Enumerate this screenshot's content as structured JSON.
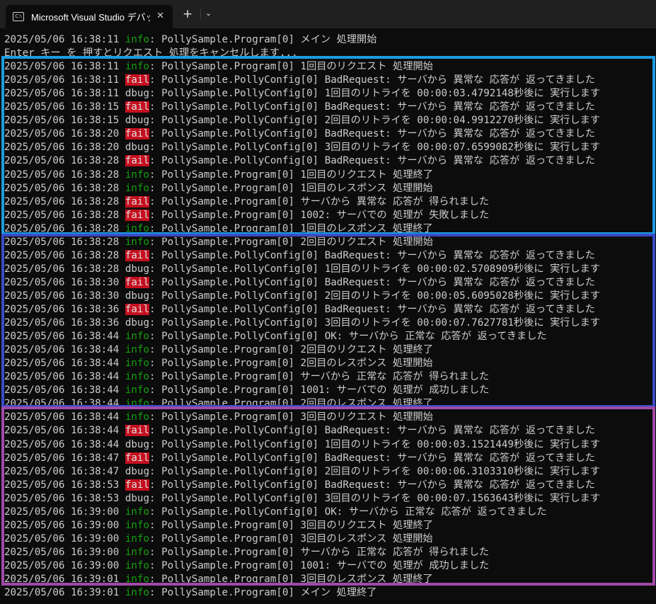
{
  "window": {
    "tab_title": "Microsoft Visual Studio デバッグ",
    "tab_icon": "C:\\",
    "close_glyph": "✕",
    "new_tab_glyph": "+",
    "dropdown_glyph": "⌄"
  },
  "box_colors": [
    "#1a9de0",
    "#3a4cc8",
    "#a04aa8"
  ],
  "lines": [
    {
      "ts": "2025/05/06 16:38:11",
      "level": "",
      "msg": "info: PollySample.Program[0] メイン 処理開始"
    },
    {
      "ts": "",
      "level": "",
      "msg": "Enter キー を 押すとリクエスト 処理をキャンセルします..."
    },
    {
      "ts": "2025/05/06 16:38:11",
      "level": "info",
      "msg": ": PollySample.Program[0] 1回目のリクエスト 処理開始"
    },
    {
      "ts": "2025/05/06 16:38:11",
      "level": "fail",
      "msg": ": PollySample.PollyConfig[0] BadRequest: サーバから 異常な 応答が 返ってきました"
    },
    {
      "ts": "2025/05/06 16:38:11",
      "level": "dbug",
      "msg": ": PollySample.PollyConfig[0] 1回目のリトライを 00:00:03.4792148秒後に 実行します"
    },
    {
      "ts": "2025/05/06 16:38:15",
      "level": "fail",
      "msg": ": PollySample.PollyConfig[0] BadRequest: サーバから 異常な 応答が 返ってきました"
    },
    {
      "ts": "2025/05/06 16:38:15",
      "level": "dbug",
      "msg": ": PollySample.PollyConfig[0] 2回目のリトライを 00:00:04.9912270秒後に 実行します"
    },
    {
      "ts": "2025/05/06 16:38:20",
      "level": "fail",
      "msg": ": PollySample.PollyConfig[0] BadRequest: サーバから 異常な 応答が 返ってきました"
    },
    {
      "ts": "2025/05/06 16:38:20",
      "level": "dbug",
      "msg": ": PollySample.PollyConfig[0] 3回目のリトライを 00:00:07.6599082秒後に 実行します"
    },
    {
      "ts": "2025/05/06 16:38:28",
      "level": "fail",
      "msg": ": PollySample.PollyConfig[0] BadRequest: サーバから 異常な 応答が 返ってきました"
    },
    {
      "ts": "2025/05/06 16:38:28",
      "level": "info",
      "msg": ": PollySample.Program[0] 1回目のリクエスト 処理終了"
    },
    {
      "ts": "2025/05/06 16:38:28",
      "level": "info",
      "msg": ": PollySample.Program[0] 1回目のレスポンス 処理開始"
    },
    {
      "ts": "2025/05/06 16:38:28",
      "level": "fail",
      "msg": ": PollySample.Program[0] サーバから 異常な 応答が 得られました"
    },
    {
      "ts": "2025/05/06 16:38:28",
      "level": "fail",
      "msg": ": PollySample.Program[0] 1002: サーバでの 処理が 失敗しました"
    },
    {
      "ts": "2025/05/06 16:38:28",
      "level": "info",
      "msg": ": PollySample.Program[0] 1回目のレスポンス 処理終了"
    },
    {
      "ts": "2025/05/06 16:38:28",
      "level": "info",
      "msg": ": PollySample.Program[0] 2回目のリクエスト 処理開始"
    },
    {
      "ts": "2025/05/06 16:38:28",
      "level": "fail",
      "msg": ": PollySample.PollyConfig[0] BadRequest: サーバから 異常な 応答が 返ってきました"
    },
    {
      "ts": "2025/05/06 16:38:28",
      "level": "dbug",
      "msg": ": PollySample.PollyConfig[0] 1回目のリトライを 00:00:02.5708909秒後に 実行します"
    },
    {
      "ts": "2025/05/06 16:38:30",
      "level": "fail",
      "msg": ": PollySample.PollyConfig[0] BadRequest: サーバから 異常な 応答が 返ってきました"
    },
    {
      "ts": "2025/05/06 16:38:30",
      "level": "dbug",
      "msg": ": PollySample.PollyConfig[0] 2回目のリトライを 00:00:05.6095028秒後に 実行します"
    },
    {
      "ts": "2025/05/06 16:38:36",
      "level": "fail",
      "msg": ": PollySample.PollyConfig[0] BadRequest: サーバから 異常な 応答が 返ってきました"
    },
    {
      "ts": "2025/05/06 16:38:36",
      "level": "dbug",
      "msg": ": PollySample.PollyConfig[0] 3回目のリトライを 00:00:07.7627781秒後に 実行します"
    },
    {
      "ts": "2025/05/06 16:38:44",
      "level": "info",
      "msg": ": PollySample.PollyConfig[0] OK: サーバから 正常な 応答が 返ってきました"
    },
    {
      "ts": "2025/05/06 16:38:44",
      "level": "info",
      "msg": ": PollySample.Program[0] 2回目のリクエスト 処理終了"
    },
    {
      "ts": "2025/05/06 16:38:44",
      "level": "info",
      "msg": ": PollySample.Program[0] 2回目のレスポンス 処理開始"
    },
    {
      "ts": "2025/05/06 16:38:44",
      "level": "info",
      "msg": ": PollySample.Program[0] サーバから 正常な 応答が 得られました"
    },
    {
      "ts": "2025/05/06 16:38:44",
      "level": "info",
      "msg": ": PollySample.Program[0] 1001: サーバでの 処理が 成功しました"
    },
    {
      "ts": "2025/05/06 16:38:44",
      "level": "info",
      "msg": ": PollySample.Program[0] 2回目のレスポンス 処理終了"
    },
    {
      "ts": "2025/05/06 16:38:44",
      "level": "info",
      "msg": ": PollySample.Program[0] 3回目のリクエスト 処理開始"
    },
    {
      "ts": "2025/05/06 16:38:44",
      "level": "fail",
      "msg": ": PollySample.PollyConfig[0] BadRequest: サーバから 異常な 応答が 返ってきました"
    },
    {
      "ts": "2025/05/06 16:38:44",
      "level": "dbug",
      "msg": ": PollySample.PollyConfig[0] 1回目のリトライを 00:00:03.1521449秒後に 実行します"
    },
    {
      "ts": "2025/05/06 16:38:47",
      "level": "fail",
      "msg": ": PollySample.PollyConfig[0] BadRequest: サーバから 異常な 応答が 返ってきました"
    },
    {
      "ts": "2025/05/06 16:38:47",
      "level": "dbug",
      "msg": ": PollySample.PollyConfig[0] 2回目のリトライを 00:00:06.3103310秒後に 実行します"
    },
    {
      "ts": "2025/05/06 16:38:53",
      "level": "fail",
      "msg": ": PollySample.PollyConfig[0] BadRequest: サーバから 異常な 応答が 返ってきました"
    },
    {
      "ts": "2025/05/06 16:38:53",
      "level": "dbug",
      "msg": ": PollySample.PollyConfig[0] 3回目のリトライを 00:00:07.1563643秒後に 実行します"
    },
    {
      "ts": "2025/05/06 16:39:00",
      "level": "info",
      "msg": ": PollySample.PollyConfig[0] OK: サーバから 正常な 応答が 返ってきました"
    },
    {
      "ts": "2025/05/06 16:39:00",
      "level": "info",
      "msg": ": PollySample.Program[0] 3回目のリクエスト 処理終了"
    },
    {
      "ts": "2025/05/06 16:39:00",
      "level": "info",
      "msg": ": PollySample.Program[0] 3回目のレスポンス 処理開始"
    },
    {
      "ts": "2025/05/06 16:39:00",
      "level": "info",
      "msg": ": PollySample.Program[0] サーバから 正常な 応答が 得られました"
    },
    {
      "ts": "2025/05/06 16:39:00",
      "level": "info",
      "msg": ": PollySample.Program[0] 1001: サーバでの 処理が 成功しました"
    },
    {
      "ts": "2025/05/06 16:39:01",
      "level": "info",
      "msg": ": PollySample.Program[0] 3回目のレスポンス 処理終了"
    },
    {
      "ts": "2025/05/06 16:39:01",
      "level": "info",
      "msg": ": PollySample.Program[0] メイン 処理終了"
    }
  ]
}
